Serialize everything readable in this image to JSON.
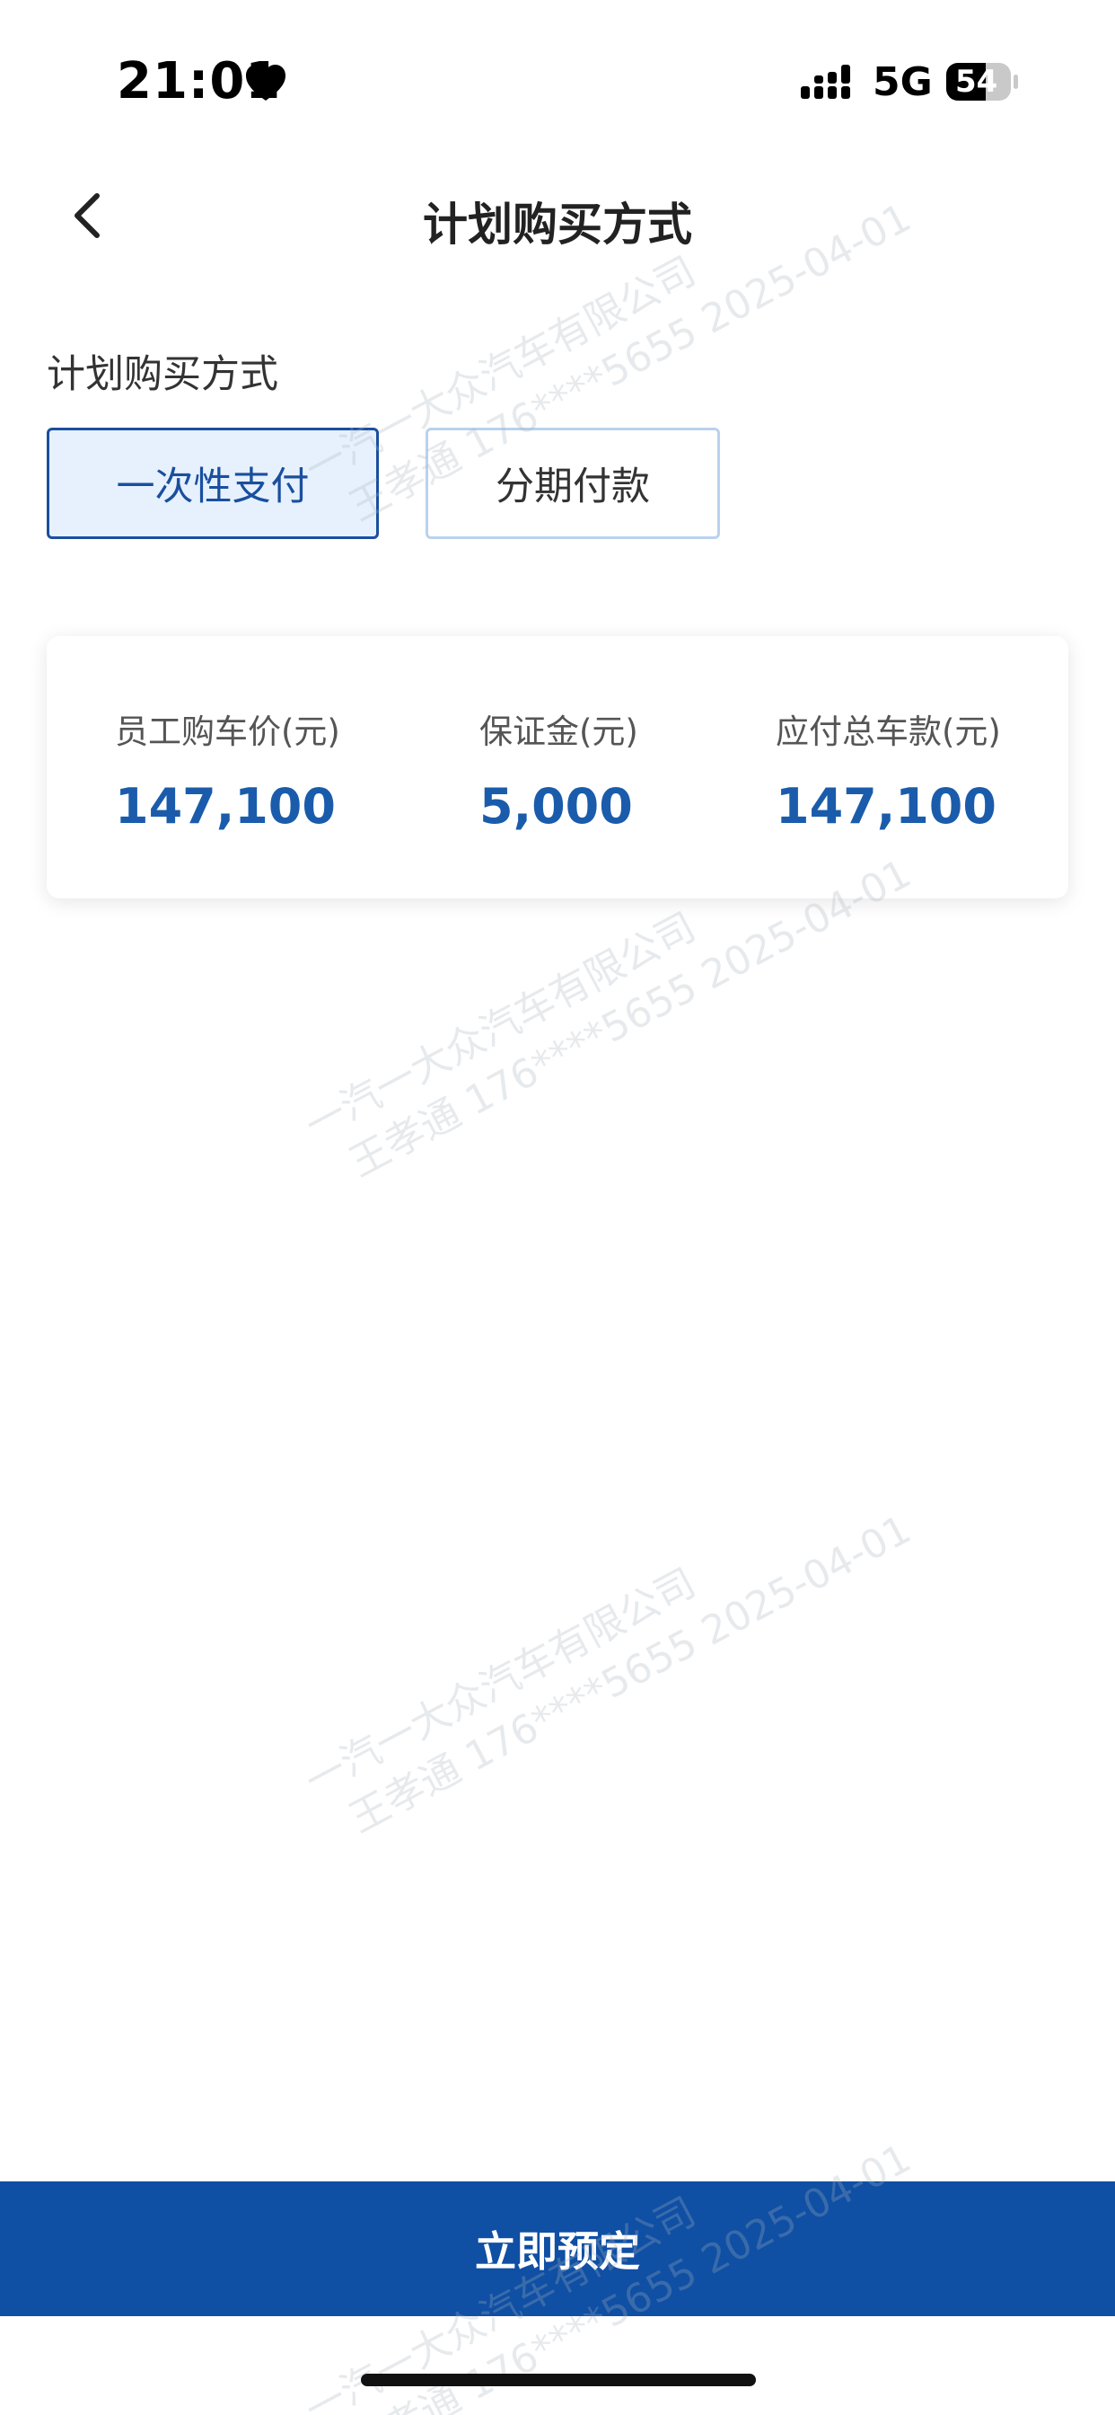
{
  "status_bar": {
    "time": "21:01",
    "network": "5G",
    "battery": "54"
  },
  "nav": {
    "title": "计划购买方式"
  },
  "payment": {
    "section_label": "计划购买方式",
    "options": [
      {
        "label": "一次性支付",
        "selected": true
      },
      {
        "label": "分期付款",
        "selected": false
      }
    ]
  },
  "price_card": {
    "items": [
      {
        "label": "员工购车价(元)",
        "value": "147,100"
      },
      {
        "label": "保证金(元)",
        "value": "5,000"
      },
      {
        "label": "应付总车款(元)",
        "value": "147,100"
      }
    ]
  },
  "watermark": {
    "line1": "一汽一大众汽车有限公司",
    "line2": "王孝通 176****5655 2025-04-01"
  },
  "cta": {
    "label": "立即预定"
  },
  "colors": {
    "primary": "#0f4fa4",
    "accent_text": "#1a5cab",
    "selected_bg": "#e6f1fd"
  },
  "icons": [
    "heart-icon",
    "signal-icon",
    "battery-icon",
    "back-icon"
  ]
}
